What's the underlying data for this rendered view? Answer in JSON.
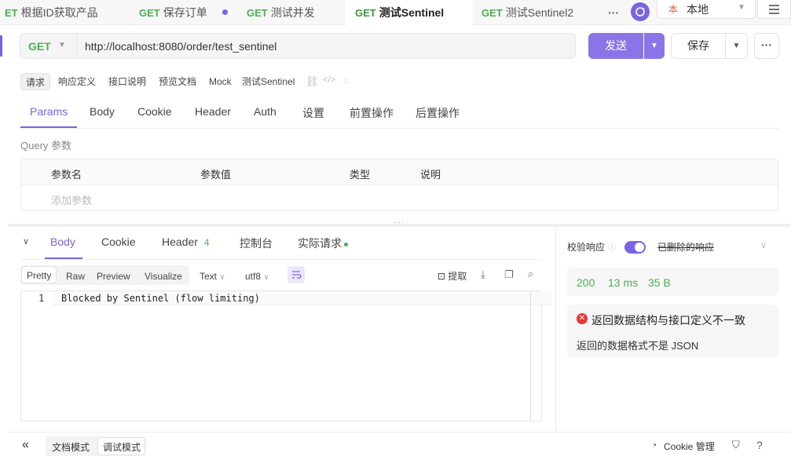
{
  "tabs": [
    {
      "method": "ET",
      "label": "根据ID获取产品"
    },
    {
      "method": "GET",
      "label": "保存订单"
    },
    {
      "method": "GET",
      "label": "测试并发"
    },
    {
      "method": "GET",
      "label": "测试Sentinel"
    },
    {
      "method": "GET",
      "label": "测试Sentinel2"
    }
  ],
  "tabs_more": "···",
  "env": {
    "badge": "本",
    "label": "本地"
  },
  "request": {
    "method": "GET",
    "url": "http://localhost:8080/order/test_sentinel",
    "send_label": "发送",
    "save_label": "保存",
    "more": "···"
  },
  "sub_tabs": [
    "请求",
    "响应定义",
    "接口说明",
    "预览文档",
    "Mock"
  ],
  "api_name": "测试Sentinel",
  "param_tabs": [
    "Params",
    "Body",
    "Cookie",
    "Header",
    "Auth",
    "设置",
    "前置操作",
    "后置操作"
  ],
  "query": {
    "title": "Query 参数",
    "columns": [
      "参数名",
      "参数值",
      "类型",
      "说明"
    ],
    "add_placeholder": "添加参数"
  },
  "response": {
    "tabs": [
      "Body",
      "Cookie",
      "Header",
      "控制台",
      "实际请求"
    ],
    "header_count": "4",
    "view_tabs": [
      "Pretty",
      "Raw",
      "Preview",
      "Visualize"
    ],
    "format": "Text",
    "encoding": "utf8",
    "extract_label": "提取",
    "lines": [
      {
        "num": "1",
        "text": "Blocked by Sentinel (flow limiting)"
      }
    ]
  },
  "validation": {
    "label": "校验响应",
    "mode": "已删除的响应",
    "status": "200",
    "time": "13 ms",
    "size": "35 B",
    "error_title": "返回数据结构与接口定义不一致",
    "error_detail": "返回的数据格式不是 JSON"
  },
  "footer": {
    "collapse": "«",
    "doc_mode": "文档模式",
    "debug_mode": "调试模式",
    "cookie_label": "Cookie 管理"
  },
  "colors": {
    "accent": "#7b63e0",
    "method_green": "#4caf50",
    "status_green": "#4caf50",
    "error_red": "#e53935"
  }
}
